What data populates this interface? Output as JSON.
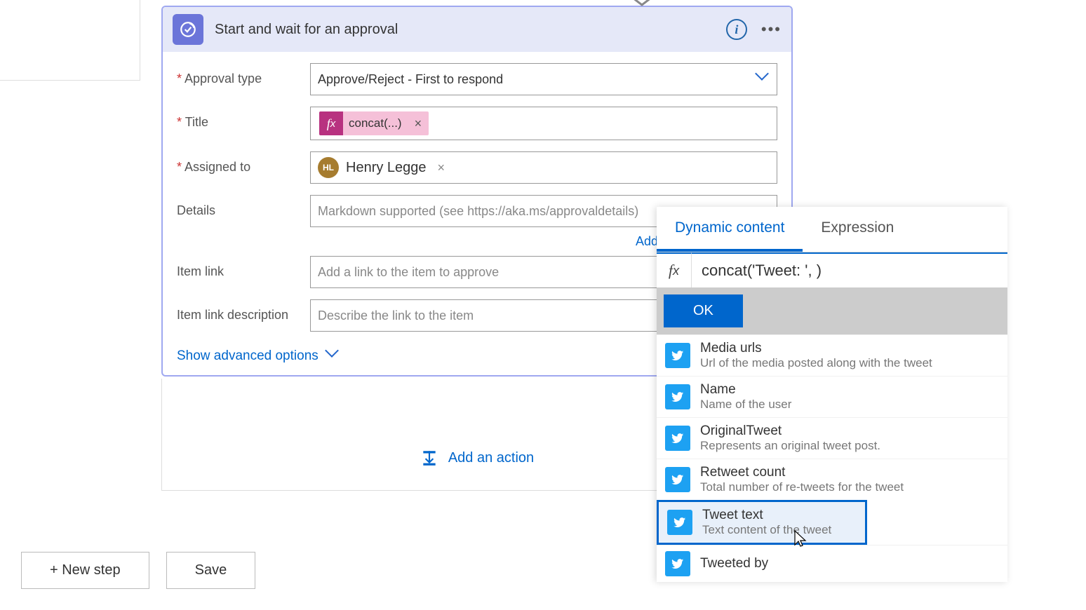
{
  "card": {
    "title": "Start and wait for an approval",
    "fields": {
      "approval_type": {
        "label": "Approval type",
        "value": "Approve/Reject - First to respond"
      },
      "title": {
        "label": "Title",
        "token": "concat(...)"
      },
      "assigned_to": {
        "label": "Assigned to",
        "initials": "HL",
        "name": "Henry Legge"
      },
      "details": {
        "label": "Details",
        "placeholder": "Markdown supported (see https://aka.ms/approvaldetails)"
      },
      "item_link": {
        "label": "Item link",
        "placeholder": "Add a link to the item to approve"
      },
      "item_link_desc": {
        "label": "Item link description",
        "placeholder": "Describe the link to the item"
      }
    },
    "add_link": "Add",
    "advanced": "Show advanced options"
  },
  "add_action": "Add an action",
  "buttons": {
    "new_step": "+ New step",
    "save": "Save"
  },
  "dynamic": {
    "tab1": "Dynamic content",
    "tab2": "Expression",
    "expression": "concat('Tweet: ', )",
    "ok": "OK",
    "items": [
      {
        "title": "Media urls",
        "desc": "Url of the media posted along with the tweet"
      },
      {
        "title": "Name",
        "desc": "Name of the user"
      },
      {
        "title": "OriginalTweet",
        "desc": "Represents an original tweet post."
      },
      {
        "title": "Retweet count",
        "desc": "Total number of re-tweets for the tweet"
      },
      {
        "title": "Tweet text",
        "desc": "Text content of the tweet"
      },
      {
        "title": "Tweeted by",
        "desc": ""
      }
    ]
  }
}
